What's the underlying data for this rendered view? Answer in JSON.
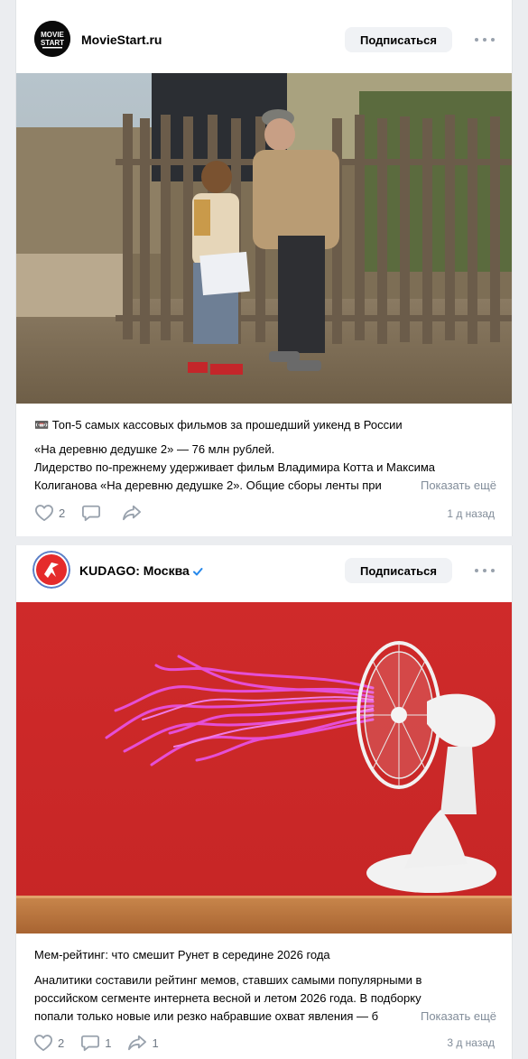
{
  "posts": [
    {
      "author": "MovieStart.ru",
      "avatar_text": "MOVIE START",
      "subscribe_label": "Подписаться",
      "title": "📼 Топ-5 самых кассовых фильмов за прошедший уикенд в России",
      "text_lines": [
        "«На деревню дедушке 2» — 76 млн рублей.",
        "Лидерство по-прежнему удерживает фильм Владимира Котта и Максима",
        "Колиганова «На деревню дедушке 2». Общие сборы ленты при"
      ],
      "show_more": "Показать ещё",
      "likes": "2",
      "comments": "",
      "shares": "",
      "time": "1 д назад"
    },
    {
      "author": "KUDAGO: Москва",
      "subscribe_label": "Подписаться",
      "title": "Мем-рейтинг: что смешит Рунет в середине 2026 года",
      "text_lines": [
        "Аналитики составили рейтинг мемов, ставших самыми популярными в",
        "российском сегменте интернета весной и летом 2026 года. В подборку",
        "попали только новые или резко набравшие охват явления — б"
      ],
      "show_more": "Показать ещё",
      "likes": "2",
      "comments": "1",
      "shares": "1",
      "time": "3 д назад"
    }
  ],
  "colors": {
    "background": "#ebedf0",
    "card": "#ffffff",
    "secondary_text": "#818c99",
    "button_bg": "#f0f2f5",
    "verified": "#2688eb",
    "kudago_red": "#e52b2b"
  }
}
